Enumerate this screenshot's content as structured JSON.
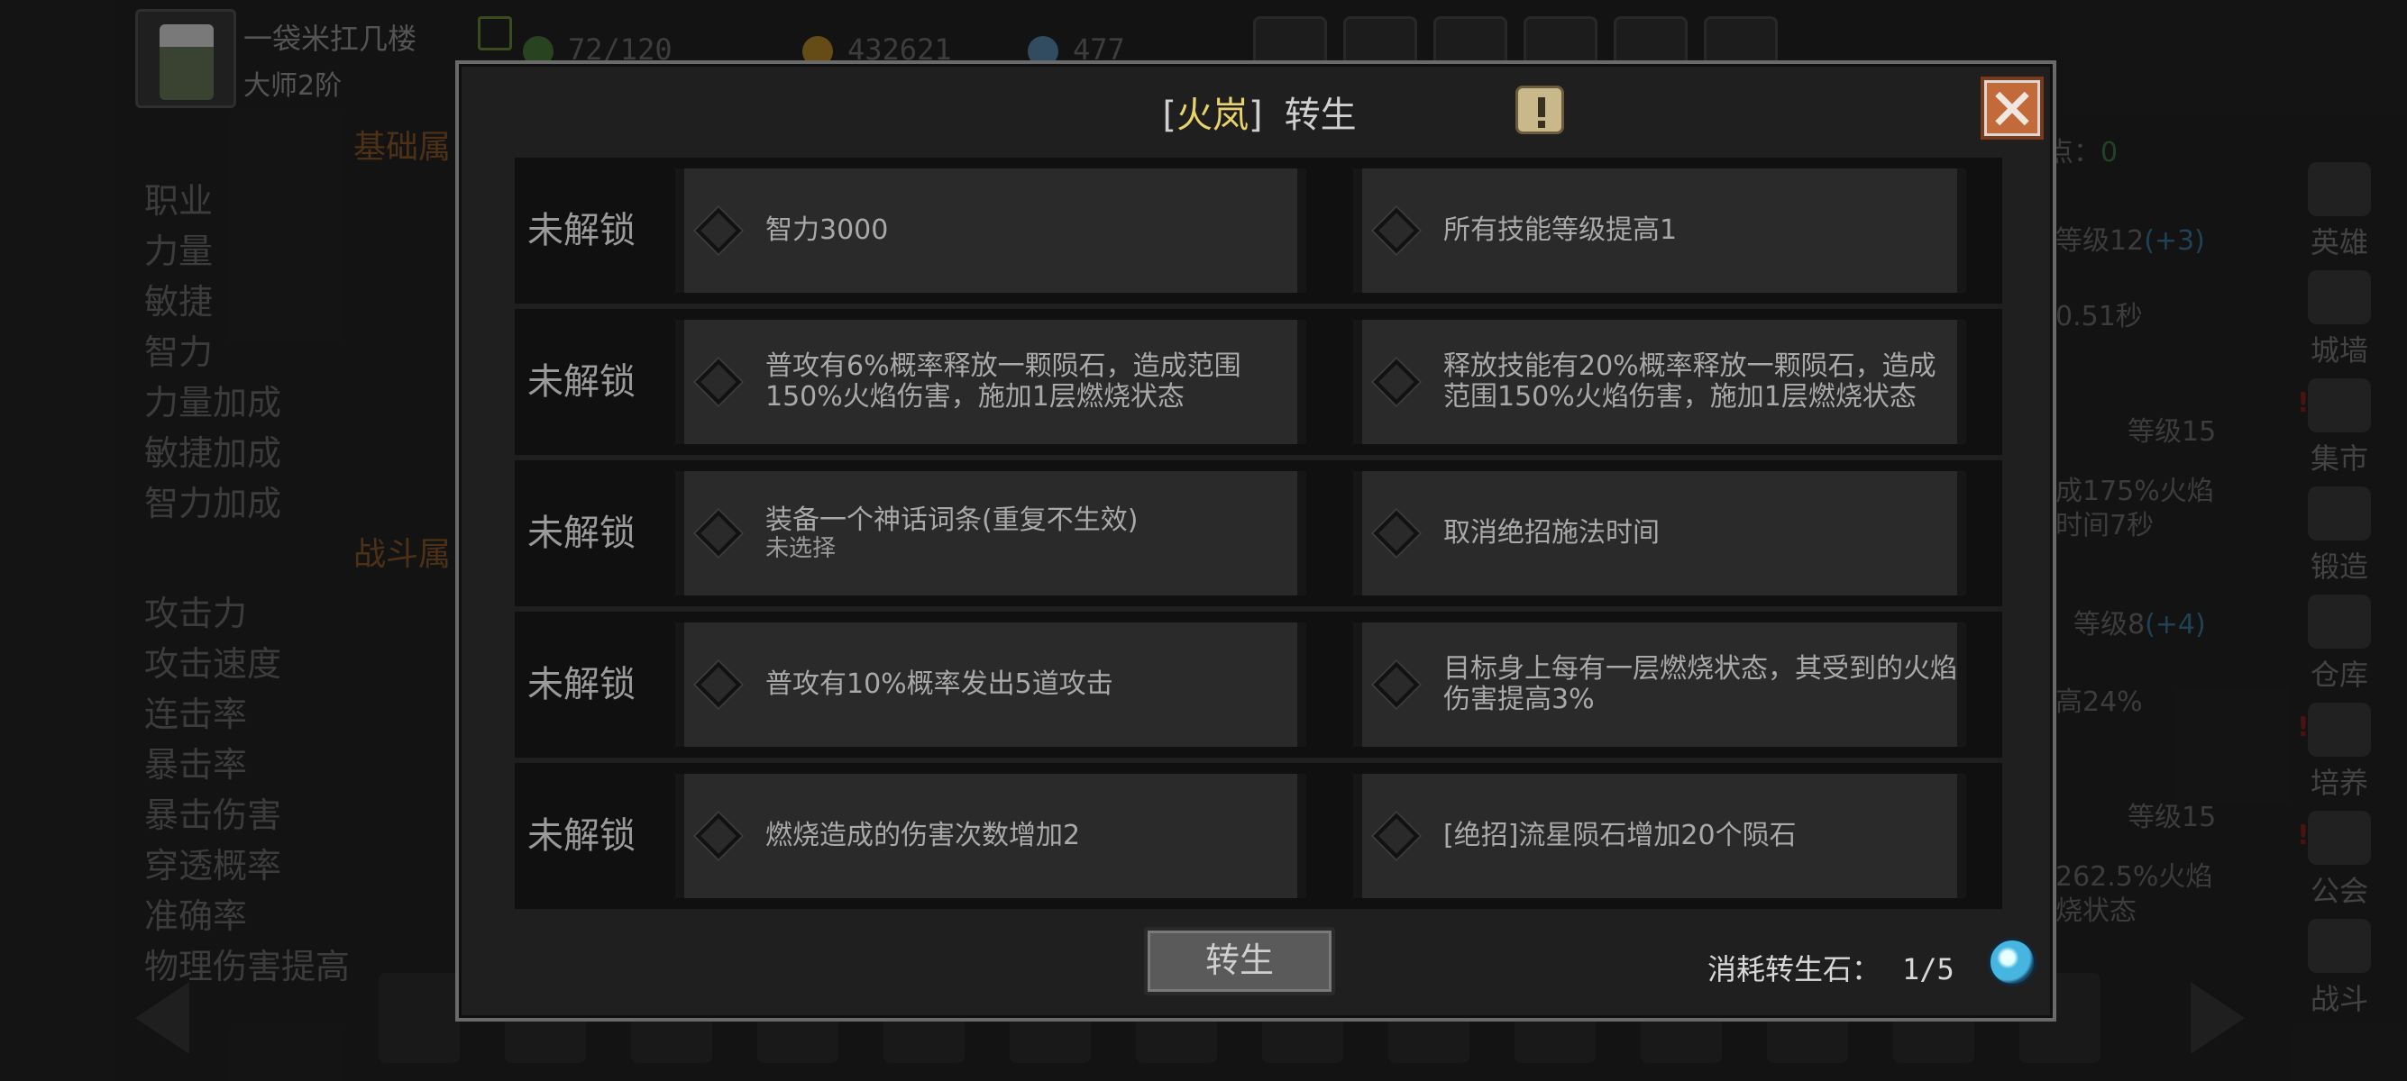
{
  "background": {
    "player": {
      "name": "一袋米扛几楼",
      "rank": "大师2阶"
    },
    "resources": [
      {
        "icon": "energy-icon",
        "value": "72/120",
        "color": "#4a7a3a"
      },
      {
        "icon": "gold-coin-icon",
        "value": "432621",
        "color": "#b88a2a"
      },
      {
        "icon": "gem-icon",
        "value": "477",
        "color": "#5a8ab0"
      }
    ],
    "left_panel": {
      "base_title": "基础属",
      "base_stats": [
        "职业",
        "力量",
        "敏捷",
        "智力",
        "力量加成",
        "敏捷加成",
        "智力加成"
      ],
      "combat_title": "战斗属",
      "combat_stats": [
        "攻击力",
        "攻击速度",
        "连击率",
        "暴击率",
        "暴击伤害",
        "穿透概率",
        "准确率",
        "物理伤害提高"
      ]
    },
    "right_panel": {
      "points_label": "点：",
      "points_value": "0",
      "lines": [
        {
          "text": "等级12",
          "extra": "(+3)"
        },
        {
          "text": "0.51秒"
        },
        {
          "text": "等级15"
        },
        {
          "text": "成175%火焰"
        },
        {
          "text": "时间7秒"
        },
        {
          "text": "等级8",
          "extra": "(+4)"
        },
        {
          "text": "高24%"
        },
        {
          "text": "等级15"
        },
        {
          "text": "262.5%火焰"
        },
        {
          "text": "烧状态"
        }
      ]
    },
    "side_nav": [
      {
        "label": "英雄",
        "alert": false
      },
      {
        "label": "城墙",
        "alert": false
      },
      {
        "label": "集市",
        "alert": true
      },
      {
        "label": "锻造",
        "alert": false
      },
      {
        "label": "仓库",
        "alert": false
      },
      {
        "label": "培养",
        "alert": true
      },
      {
        "label": "公会",
        "alert": true
      },
      {
        "label": "战斗",
        "alert": false
      }
    ]
  },
  "modal": {
    "title": {
      "open_bracket": "[",
      "hero_name": "火岚",
      "close_bracket": "]",
      "action": "转生"
    },
    "rows": [
      {
        "status": "未解锁",
        "left": {
          "text": "智力3000",
          "sub": ""
        },
        "right": {
          "text": "所有技能等级提高1"
        }
      },
      {
        "status": "未解锁",
        "left": {
          "text": "普攻有6%概率释放一颗陨石，造成范围150%火焰伤害，施加1层燃烧状态",
          "sub": ""
        },
        "right": {
          "text": "释放技能有20%概率释放一颗陨石，造成范围150%火焰伤害，施加1层燃烧状态"
        }
      },
      {
        "status": "未解锁",
        "left": {
          "text": "装备一个神话词条(重复不生效)",
          "sub": "未选择"
        },
        "right": {
          "text": "取消绝招施法时间"
        }
      },
      {
        "status": "未解锁",
        "left": {
          "text": "普攻有10%概率发出5道攻击",
          "sub": ""
        },
        "right": {
          "text": "目标身上每有一层燃烧状态，其受到的火焰伤害提高3%"
        }
      },
      {
        "status": "未解锁",
        "left": {
          "text": "燃烧造成的伤害次数增加2",
          "sub": ""
        },
        "right": {
          "text": "[绝招]流星陨石增加20个陨石"
        }
      }
    ],
    "rebirth_button": "转生",
    "cost": {
      "label": "消耗转生石：",
      "value": "1/5"
    }
  }
}
